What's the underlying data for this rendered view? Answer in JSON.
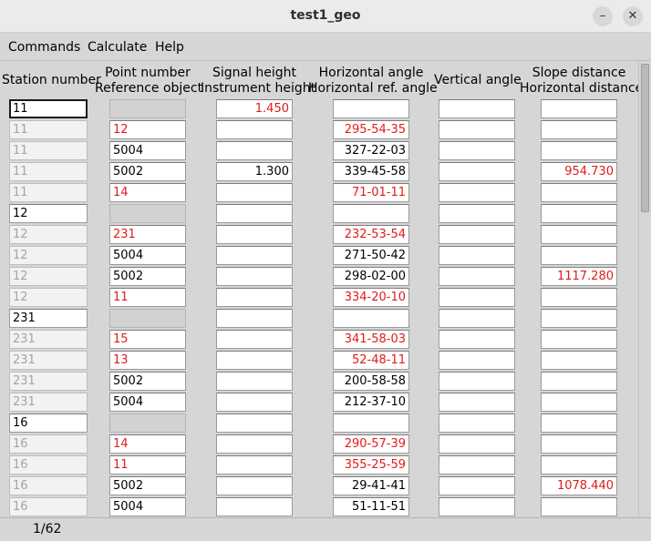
{
  "window": {
    "title": "test1_geo",
    "minimize_glyph": "–",
    "close_glyph": "✕"
  },
  "menu": [
    "Commands",
    "Calculate",
    "Help"
  ],
  "columns": [
    {
      "line1": "Station number",
      "line2": ""
    },
    {
      "line1": "Point number",
      "line2": "Reference object"
    },
    {
      "line1": "Signal height",
      "line2": "Instrument height"
    },
    {
      "line1": "Horizontal angle",
      "line2": "Horizontal ref. angle"
    },
    {
      "line1": "Vertical angle",
      "line2": ""
    },
    {
      "line1": "Slope distance",
      "line2": "Horizontal distance"
    }
  ],
  "colors": {
    "red_text": "#e01b1b",
    "ghost_text": "#a4a4a4"
  },
  "rows": [
    {
      "station": "11",
      "type": "station",
      "point": "",
      "point_red": false,
      "signal": "1.450",
      "signal_red": true,
      "hz": "",
      "hz_red": false,
      "vert": "",
      "dist": "",
      "dist_red": false,
      "active": true
    },
    {
      "station": "11",
      "type": "obs",
      "point": "12",
      "point_red": true,
      "signal": "",
      "signal_red": false,
      "hz": "295-54-35",
      "hz_red": true,
      "vert": "",
      "dist": "",
      "dist_red": false
    },
    {
      "station": "11",
      "type": "obs",
      "point": "5004",
      "point_red": false,
      "signal": "",
      "signal_red": false,
      "hz": "327-22-03",
      "hz_red": false,
      "vert": "",
      "dist": "",
      "dist_red": false
    },
    {
      "station": "11",
      "type": "obs",
      "point": "5002",
      "point_red": false,
      "signal": "1.300",
      "signal_red": false,
      "hz": "339-45-58",
      "hz_red": false,
      "vert": "",
      "dist": "954.730",
      "dist_red": true
    },
    {
      "station": "11",
      "type": "obs",
      "point": "14",
      "point_red": true,
      "signal": "",
      "signal_red": false,
      "hz": "71-01-11",
      "hz_red": true,
      "vert": "",
      "dist": "",
      "dist_red": false
    },
    {
      "station": "12",
      "type": "station",
      "point": "",
      "point_red": false,
      "signal": "",
      "signal_red": false,
      "hz": "",
      "hz_red": false,
      "vert": "",
      "dist": "",
      "dist_red": false
    },
    {
      "station": "12",
      "type": "obs",
      "point": "231",
      "point_red": true,
      "signal": "",
      "signal_red": false,
      "hz": "232-53-54",
      "hz_red": true,
      "vert": "",
      "dist": "",
      "dist_red": false
    },
    {
      "station": "12",
      "type": "obs",
      "point": "5004",
      "point_red": false,
      "signal": "",
      "signal_red": false,
      "hz": "271-50-42",
      "hz_red": false,
      "vert": "",
      "dist": "",
      "dist_red": false
    },
    {
      "station": "12",
      "type": "obs",
      "point": "5002",
      "point_red": false,
      "signal": "",
      "signal_red": false,
      "hz": "298-02-00",
      "hz_red": false,
      "vert": "",
      "dist": "1117.280",
      "dist_red": true
    },
    {
      "station": "12",
      "type": "obs",
      "point": "11",
      "point_red": true,
      "signal": "",
      "signal_red": false,
      "hz": "334-20-10",
      "hz_red": true,
      "vert": "",
      "dist": "",
      "dist_red": false
    },
    {
      "station": "231",
      "type": "station",
      "point": "",
      "point_red": false,
      "signal": "",
      "signal_red": false,
      "hz": "",
      "hz_red": false,
      "vert": "",
      "dist": "",
      "dist_red": false
    },
    {
      "station": "231",
      "type": "obs",
      "point": "15",
      "point_red": true,
      "signal": "",
      "signal_red": false,
      "hz": "341-58-03",
      "hz_red": true,
      "vert": "",
      "dist": "",
      "dist_red": false
    },
    {
      "station": "231",
      "type": "obs",
      "point": "13",
      "point_red": true,
      "signal": "",
      "signal_red": false,
      "hz": "52-48-11",
      "hz_red": true,
      "vert": "",
      "dist": "",
      "dist_red": false
    },
    {
      "station": "231",
      "type": "obs",
      "point": "5002",
      "point_red": false,
      "signal": "",
      "signal_red": false,
      "hz": "200-58-58",
      "hz_red": false,
      "vert": "",
      "dist": "",
      "dist_red": false
    },
    {
      "station": "231",
      "type": "obs",
      "point": "5004",
      "point_red": false,
      "signal": "",
      "signal_red": false,
      "hz": "212-37-10",
      "hz_red": false,
      "vert": "",
      "dist": "",
      "dist_red": false
    },
    {
      "station": "16",
      "type": "station",
      "point": "",
      "point_red": false,
      "signal": "",
      "signal_red": false,
      "hz": "",
      "hz_red": false,
      "vert": "",
      "dist": "",
      "dist_red": false
    },
    {
      "station": "16",
      "type": "obs",
      "point": "14",
      "point_red": true,
      "signal": "",
      "signal_red": false,
      "hz": "290-57-39",
      "hz_red": true,
      "vert": "",
      "dist": "",
      "dist_red": false
    },
    {
      "station": "16",
      "type": "obs",
      "point": "11",
      "point_red": true,
      "signal": "",
      "signal_red": false,
      "hz": "355-25-59",
      "hz_red": true,
      "vert": "",
      "dist": "",
      "dist_red": false
    },
    {
      "station": "16",
      "type": "obs",
      "point": "5002",
      "point_red": false,
      "signal": "",
      "signal_red": false,
      "hz": "29-41-41",
      "hz_red": false,
      "vert": "",
      "dist": "1078.440",
      "dist_red": true
    },
    {
      "station": "16",
      "type": "obs",
      "point": "5004",
      "point_red": false,
      "signal": "",
      "signal_red": false,
      "hz": "51-11-51",
      "hz_red": false,
      "vert": "",
      "dist": "",
      "dist_red": false
    }
  ],
  "status": "1/62"
}
